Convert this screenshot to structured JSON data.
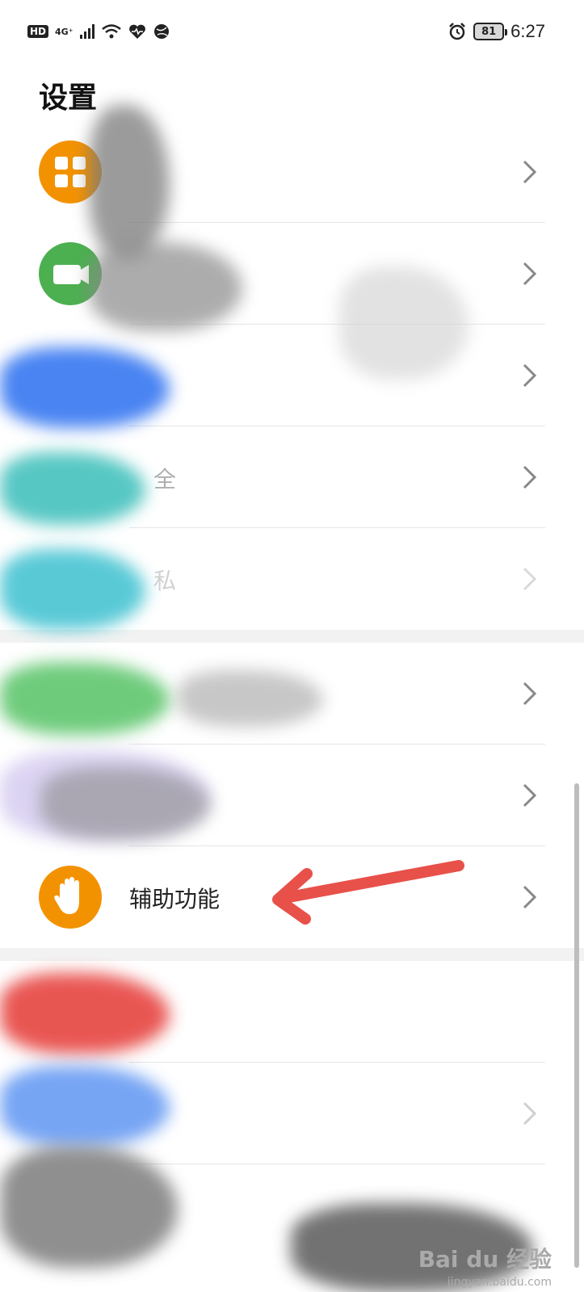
{
  "status_bar": {
    "hd": "HD",
    "network": "4G⁺",
    "battery": "81",
    "time": "6:27"
  },
  "page": {
    "title": "设置"
  },
  "rows": [
    {
      "label": "",
      "icon": "apps-grid-icon",
      "color": "#f39200"
    },
    {
      "label": "",
      "icon": "camera-icon",
      "color": "#4caf50"
    },
    {
      "label": "",
      "icon": "blue-icon",
      "color": "#2a6ff0"
    },
    {
      "label": "全",
      "icon": "teal-icon",
      "color": "#1fb5b0"
    },
    {
      "label": "私",
      "icon": "cyan-icon",
      "color": "#22b8c9"
    },
    {
      "label": "",
      "icon": "green-icon",
      "color": "#4bbf5c"
    },
    {
      "label": "",
      "icon": "purple-icon",
      "color": "#b9a8e6"
    },
    {
      "label": "辅助功能",
      "icon": "hand-icon",
      "color": "#f39200"
    },
    {
      "label": "",
      "icon": "red-icon",
      "color": "#e53935"
    },
    {
      "label": "",
      "icon": "blue-icon",
      "color": "#3d7ff0"
    },
    {
      "label": "",
      "icon": "gray-icon",
      "color": "#888888"
    }
  ],
  "annotation": {
    "arrow_color": "#e8504a"
  },
  "watermark": {
    "logo": "Bai du 经验",
    "sub": "jingyan.baidu.com"
  }
}
